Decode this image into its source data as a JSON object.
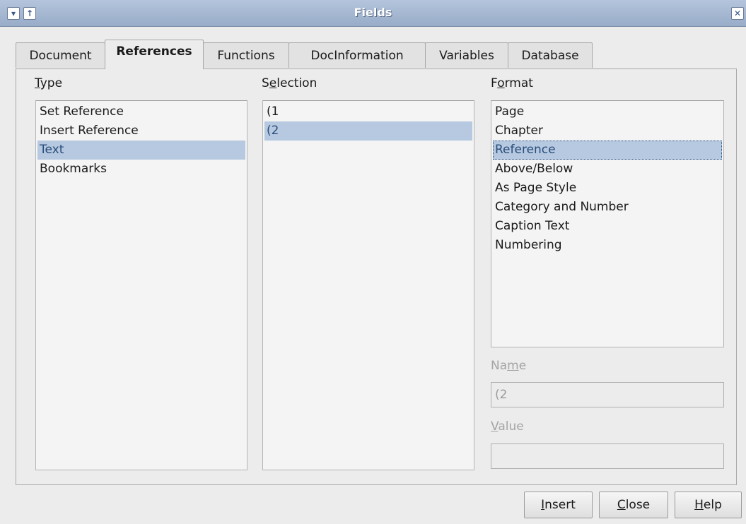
{
  "window": {
    "title": "Fields"
  },
  "tabs": [
    {
      "label": "Document"
    },
    {
      "label": "References"
    },
    {
      "label": "Functions"
    },
    {
      "label": "DocInformation"
    },
    {
      "label": "Variables"
    },
    {
      "label": "Database"
    }
  ],
  "active_tab": "References",
  "type": {
    "label_u": "T",
    "label_rest": "ype",
    "items": [
      "Set Reference",
      "Insert Reference",
      "Text",
      "Bookmarks"
    ],
    "selected": "Text"
  },
  "selection": {
    "label_pre": "S",
    "label_u": "e",
    "label_rest": "lection",
    "items": [
      "(1",
      "(2"
    ],
    "selected": "(2"
  },
  "format": {
    "label_pre": "F",
    "label_u": "o",
    "label_rest": "rmat",
    "items": [
      "Page",
      "Chapter",
      "Reference",
      "Above/Below",
      "As Page Style",
      "Category and Number",
      "Caption Text",
      "Numbering"
    ],
    "selected": "Reference"
  },
  "name": {
    "label_pre": "Na",
    "label_u": "m",
    "label_rest": "e",
    "value": "(2"
  },
  "value": {
    "label_u": "V",
    "label_rest": "alue",
    "value": ""
  },
  "buttons": {
    "insert": {
      "u": "I",
      "rest": "nsert"
    },
    "close": {
      "u": "C",
      "rest": "lose"
    },
    "help": {
      "u": "H",
      "rest": "elp"
    }
  }
}
